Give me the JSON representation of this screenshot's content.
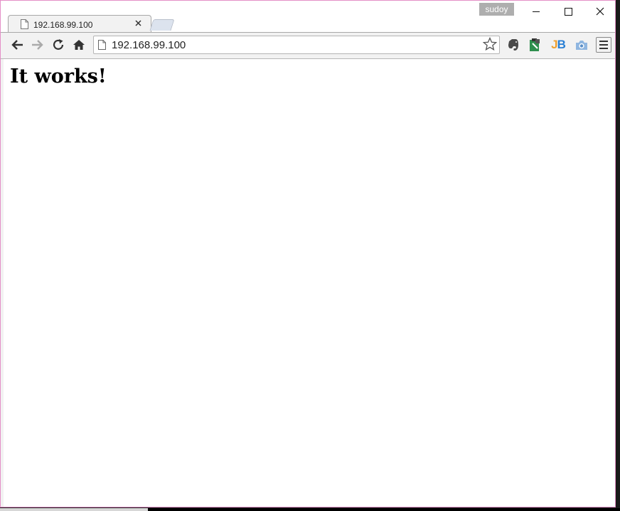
{
  "window": {
    "profile_name": "sudoy"
  },
  "tab": {
    "title": "192.168.99.100"
  },
  "toolbar": {
    "url": "192.168.99.100",
    "extensions": {
      "jb_label": "JB"
    }
  },
  "page": {
    "heading": "It works!"
  },
  "colors": {
    "window_border": "#e48fc7",
    "profile_badge": "#aeaeae",
    "jb_orange": "#f0a030",
    "jb_blue": "#2a7fd4"
  }
}
